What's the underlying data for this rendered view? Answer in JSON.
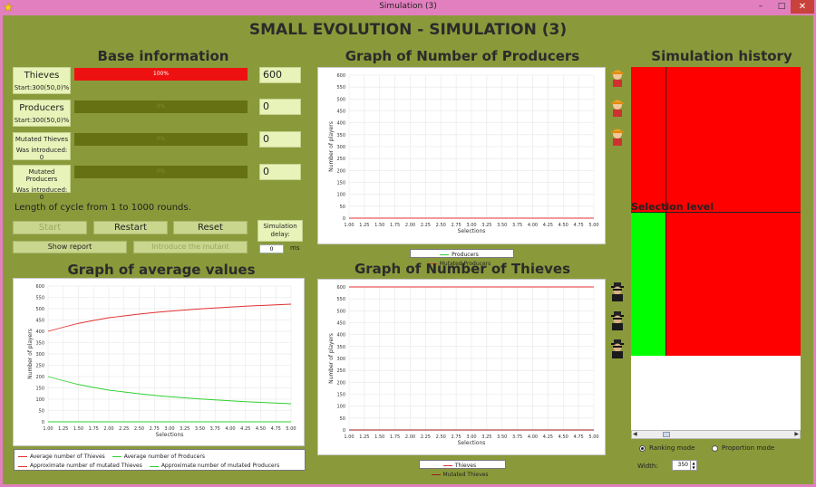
{
  "window": {
    "title": "Simulation (3)",
    "min": "–",
    "max": "□",
    "close": "✕"
  },
  "main_title": "SMALL EVOLUTION - SIMULATION (3)",
  "base": {
    "title": "Base information",
    "rows": [
      {
        "label": "Thieves",
        "sub": "Start:300(50,0)%",
        "bar_text": "100%",
        "fraction": 1.0,
        "value": "600"
      },
      {
        "label": "Producers",
        "sub": "Start:300(50,0)%",
        "bar_text": "0%",
        "fraction": 0.0,
        "value": "0"
      },
      {
        "label": "Mutated Thieves",
        "sub": "Was introduced: 0",
        "bar_text": "0%",
        "fraction": 0.0,
        "value": "0"
      },
      {
        "label": "Mutated Producers",
        "sub": "Was introduced: 0",
        "bar_text": "0%",
        "fraction": 0.0,
        "value": "0"
      }
    ],
    "cycle_text": "Length of cycle from 1 to 1000 rounds.",
    "buttons": {
      "start": "Start",
      "restart": "Restart",
      "reset": "Reset",
      "show_report": "Show report",
      "introduce": "Introduce the mutant"
    },
    "delay_label": "Simulation delay:",
    "delay_value": "0",
    "ms": "ms"
  },
  "avg_graph": {
    "title": "Graph of average values",
    "legend": [
      "Average number of Thieves",
      "Average number of Producers",
      "Approximate number of mutated Thieves",
      "Approximate number of mutated Producers"
    ],
    "colors": [
      "#e03030",
      "#30d030",
      "#e03030",
      "#30d030"
    ]
  },
  "producers_graph": {
    "title": "Graph of Number of Producers",
    "legend": [
      "Producers",
      "Mutated Producers"
    ]
  },
  "thieves_graph": {
    "title": "Graph of Number of Thieves",
    "legend": [
      "Thieves",
      "Mutated Thieves"
    ]
  },
  "history": {
    "title": "Simulation history",
    "selection_label": "Selection level",
    "radio": {
      "ranking": "Ranking mode",
      "proportion": "Proportion mode"
    },
    "width_label": "Width:",
    "width_value": "350"
  },
  "chart_data": [
    {
      "type": "line",
      "title": "Graph of average values",
      "xlabel": "Selections",
      "ylabel": "Number of players",
      "x": [
        1.0,
        1.25,
        1.5,
        1.75,
        2.0,
        2.25,
        2.5,
        2.75,
        3.0,
        3.25,
        3.5,
        3.75,
        4.0,
        4.25,
        4.5,
        4.75,
        5.0
      ],
      "ylim": [
        0,
        600
      ],
      "yticks": [
        0,
        50,
        100,
        150,
        200,
        250,
        300,
        350,
        400,
        450,
        500,
        550,
        600
      ],
      "xticks": [
        "1.00",
        "1.25",
        "1.50",
        "1.75",
        "2.00",
        "2.25",
        "2.50",
        "2.75",
        "3.00",
        "3.25",
        "3.50",
        "3.75",
        "4.00",
        "4.25",
        "4.50",
        "4.75",
        "5.00"
      ],
      "series": [
        {
          "name": "Average number of Thieves",
          "values": [
            400,
            418,
            435,
            448,
            460,
            468,
            476,
            483,
            489,
            494,
            499,
            503,
            507,
            511,
            514,
            517,
            520
          ]
        },
        {
          "name": "Average number of Producers",
          "values": [
            200,
            182,
            165,
            152,
            140,
            132,
            124,
            117,
            111,
            106,
            101,
            97,
            93,
            89,
            86,
            83,
            80
          ]
        },
        {
          "name": "Approximate number of mutated Thieves",
          "values": [
            0,
            0,
            0,
            0,
            0,
            0,
            0,
            0,
            0,
            0,
            0,
            0,
            0,
            0,
            0,
            0,
            0
          ]
        },
        {
          "name": "Approximate number of mutated Producers",
          "values": [
            0,
            0,
            0,
            0,
            0,
            0,
            0,
            0,
            0,
            0,
            0,
            0,
            0,
            0,
            0,
            0,
            0
          ]
        }
      ]
    },
    {
      "type": "line",
      "title": "Graph of Number of Producers",
      "xlabel": "Selections",
      "ylabel": "Number of players",
      "x": [
        1.0,
        5.0
      ],
      "ylim": [
        0,
        600
      ],
      "yticks": [
        0,
        50,
        100,
        150,
        200,
        250,
        300,
        350,
        400,
        450,
        500,
        550,
        600
      ],
      "xticks": [
        "1.00",
        "1.25",
        "1.50",
        "1.75",
        "2.00",
        "2.25",
        "2.50",
        "2.75",
        "3.00",
        "3.25",
        "3.50",
        "3.75",
        "4.00",
        "4.25",
        "4.50",
        "4.75",
        "5.00"
      ],
      "series": [
        {
          "name": "Producers",
          "values": [
            0,
            0
          ]
        },
        {
          "name": "Mutated Producers",
          "values": [
            0,
            0
          ]
        }
      ]
    },
    {
      "type": "line",
      "title": "Graph of Number of Thieves",
      "xlabel": "Selections",
      "ylabel": "Number of players",
      "x": [
        1.0,
        5.0
      ],
      "ylim": [
        0,
        600
      ],
      "yticks": [
        0,
        50,
        100,
        150,
        200,
        250,
        300,
        350,
        400,
        450,
        500,
        550,
        600
      ],
      "xticks": [
        "1.00",
        "1.25",
        "1.50",
        "1.75",
        "2.00",
        "2.25",
        "2.50",
        "2.75",
        "3.00",
        "3.25",
        "3.50",
        "3.75",
        "4.00",
        "4.25",
        "4.50",
        "4.75",
        "5.00"
      ],
      "series": [
        {
          "name": "Thieves",
          "values": [
            600,
            600
          ]
        },
        {
          "name": "Mutated Thieves",
          "values": [
            0,
            0
          ]
        }
      ]
    }
  ]
}
